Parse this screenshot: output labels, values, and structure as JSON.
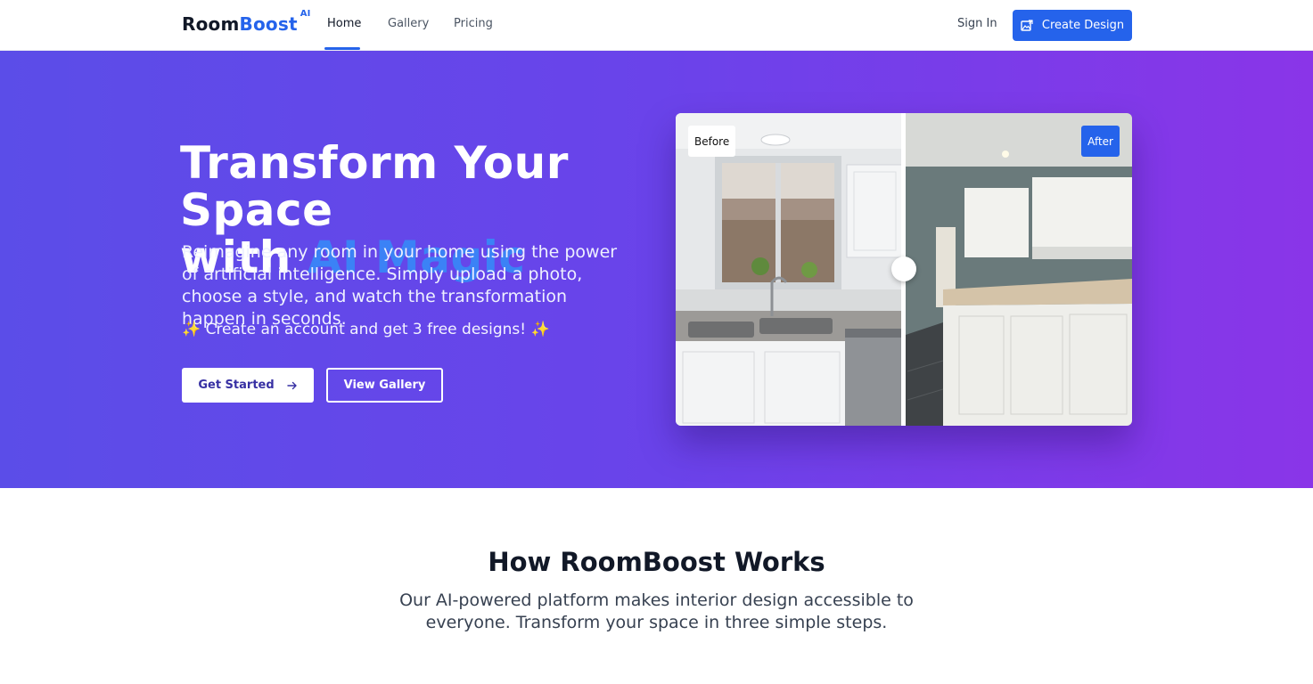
{
  "brand": {
    "name_part1": "Room",
    "name_part2": "Boost",
    "suffix": "AI"
  },
  "nav": {
    "links": [
      {
        "label": "Home",
        "active": true
      },
      {
        "label": "Gallery",
        "active": false
      },
      {
        "label": "Pricing",
        "active": false
      }
    ],
    "sign_in": "Sign In",
    "create_design": "Create Design",
    "create_design_icon": "image-edit-icon"
  },
  "hero": {
    "title_line1": "Transform Your Space",
    "title_with": "with",
    "title_highlight": "AI Magic",
    "description": "Reimagine any room in your home using the power of artificial intelligence. Simply upload a photo, choose a style, and watch the transformation happen in seconds.",
    "promo": "✨ Create an account and get 3 free designs! ✨",
    "cta_primary": "Get Started",
    "cta_primary_icon": "arrow-right-icon",
    "cta_secondary": "View Gallery"
  },
  "compare": {
    "before_label": "Before",
    "after_label": "After"
  },
  "how": {
    "title": "How RoomBoost Works",
    "description": "Our AI-powered platform makes interior design accessible to everyone. Transform your space in three simple steps."
  },
  "colors": {
    "accent": "#2563eb",
    "hero_start": "#5b4de8",
    "hero_end": "#8a35e8"
  }
}
